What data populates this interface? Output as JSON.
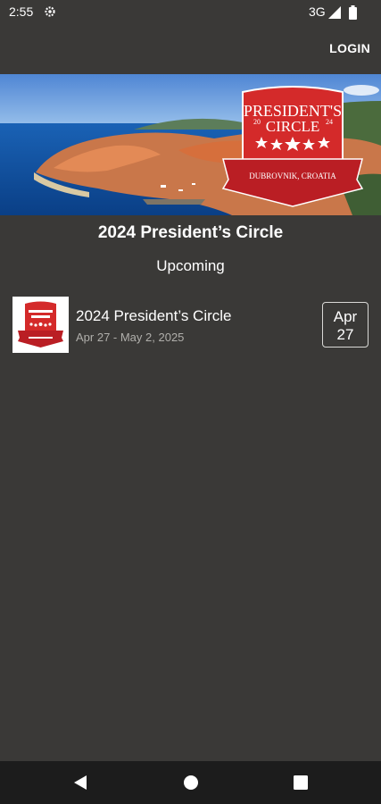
{
  "status_bar": {
    "time": "2:55",
    "network": "3G",
    "icons": [
      "settings-gear-icon",
      "signal-icon",
      "battery-icon"
    ]
  },
  "app_bar": {
    "login_label": "LOGIN"
  },
  "hero": {
    "badge_line1": "PRESIDENT'S",
    "badge_line2": "CIRCLE",
    "badge_year_left": "20",
    "badge_year_right": "24",
    "badge_location": "DUBROVNIK, CROATIA"
  },
  "event": {
    "title": "2024 President’s Circle",
    "section_label": "Upcoming"
  },
  "events_list": [
    {
      "title": "2024 President’s Circle",
      "dates": "Apr 27 - May 2, 2025",
      "month": "Apr",
      "day": "27"
    }
  ],
  "colors": {
    "background": "#3a3937",
    "badge_red": "#d42a2a",
    "nav_bar": "#1c1c1c"
  },
  "nav_bar": {
    "icons": [
      "back-icon",
      "home-icon",
      "recents-icon"
    ]
  }
}
